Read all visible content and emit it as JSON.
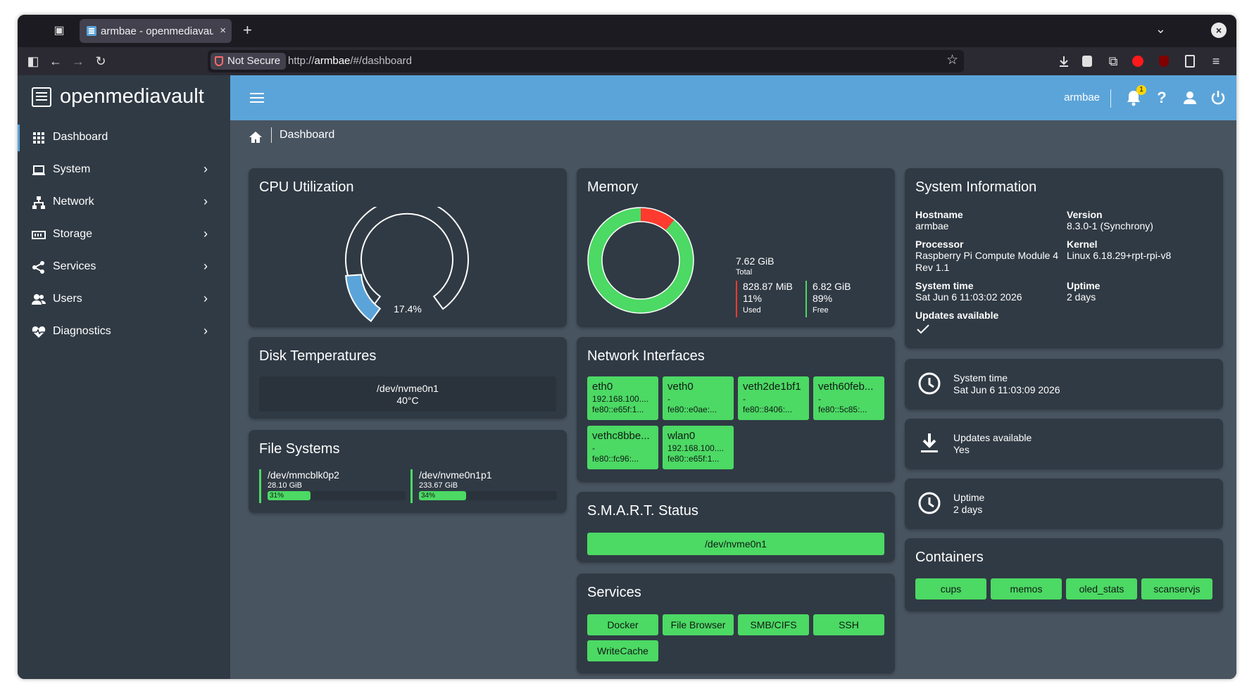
{
  "browser": {
    "tab_title": "armbae - openmediavault",
    "tab_close": "×",
    "new_tab": "+",
    "security_label": "Not Secure",
    "url_prefix": "http://",
    "url_host": "armbae",
    "url_path": "/#/dashboard"
  },
  "app": {
    "logo_text": "openmediavault",
    "user": "armbae",
    "notification_count": "1",
    "breadcrumb": "Dashboard"
  },
  "sidebar": {
    "items": [
      {
        "label": "Dashboard",
        "icon": "grid-icon"
      },
      {
        "label": "System",
        "icon": "laptop-icon"
      },
      {
        "label": "Network",
        "icon": "network-icon"
      },
      {
        "label": "Storage",
        "icon": "storage-icon"
      },
      {
        "label": "Services",
        "icon": "share-icon"
      },
      {
        "label": "Users",
        "icon": "users-icon"
      },
      {
        "label": "Diagnostics",
        "icon": "heartbeat-icon"
      }
    ]
  },
  "cpu": {
    "title": "CPU Utilization",
    "value_label": "17.4%",
    "value": 17.4
  },
  "disk_temps": {
    "title": "Disk Temperatures",
    "device": "/dev/nvme0n1",
    "temp": "40°C"
  },
  "filesystems": {
    "title": "File Systems",
    "items": [
      {
        "device": "/dev/mmcblk0p2",
        "size": "28.10 GiB",
        "percent_label": "31%",
        "percent": 31
      },
      {
        "device": "/dev/nvme0n1p1",
        "size": "233.67 GiB",
        "percent_label": "34%",
        "percent": 34
      }
    ]
  },
  "memory": {
    "title": "Memory",
    "total_value": "7.62 GiB",
    "total_label": "Total",
    "used_value": "828.87 MiB",
    "used_pct": "11%",
    "used_label": "Used",
    "free_value": "6.82 GiB",
    "free_pct": "89%",
    "free_label": "Free",
    "used_fraction": 0.11
  },
  "network": {
    "title": "Network Interfaces",
    "interfaces": [
      {
        "name": "eth0",
        "ipv4": "192.168.100....",
        "ipv6": "fe80::e65f:1..."
      },
      {
        "name": "veth0",
        "ipv4": "-",
        "ipv6": "fe80::e0ae:..."
      },
      {
        "name": "veth2de1bf1",
        "ipv4": "-",
        "ipv6": "fe80::8406:..."
      },
      {
        "name": "veth60feb...",
        "ipv4": "-",
        "ipv6": "fe80::5c85:..."
      },
      {
        "name": "vethc8bbe...",
        "ipv4": "-",
        "ipv6": "fe80::fc96:..."
      },
      {
        "name": "wlan0",
        "ipv4": "192.168.100....",
        "ipv6": "fe80::e65f:1..."
      }
    ]
  },
  "smart": {
    "title": "S.M.A.R.T. Status",
    "device": "/dev/nvme0n1"
  },
  "services": {
    "title": "Services",
    "items": [
      "Docker",
      "File Browser",
      "SMB/CIFS",
      "SSH",
      "WriteCache"
    ]
  },
  "sysinfo": {
    "title": "System Information",
    "hostname_label": "Hostname",
    "hostname": "armbae",
    "version_label": "Version",
    "version": "8.3.0-1 (Synchrony)",
    "processor_label": "Processor",
    "processor": "Raspberry Pi Compute Module 4 Rev 1.1",
    "kernel_label": "Kernel",
    "kernel": "Linux 6.18.29+rpt-rpi-v8",
    "systime_label": "System time",
    "systime": "Sat Jun 6 11:03:02 2026",
    "uptime_label": "Uptime",
    "uptime": "2 days",
    "updates_label": "Updates available"
  },
  "widget_systime": {
    "label": "System time",
    "value": "Sat Jun 6 11:03:09 2026"
  },
  "widget_updates": {
    "label": "Updates available",
    "value": "Yes"
  },
  "widget_uptime": {
    "label": "Uptime",
    "value": "2 days"
  },
  "containers": {
    "title": "Containers",
    "items": [
      "cups",
      "memos",
      "oled_stats",
      "scanservjs"
    ]
  },
  "colors": {
    "accent": "#5ba4d9",
    "ok": "#4cd964",
    "used": "#ff3b30",
    "panel": "#303a44",
    "background": "#495461"
  }
}
